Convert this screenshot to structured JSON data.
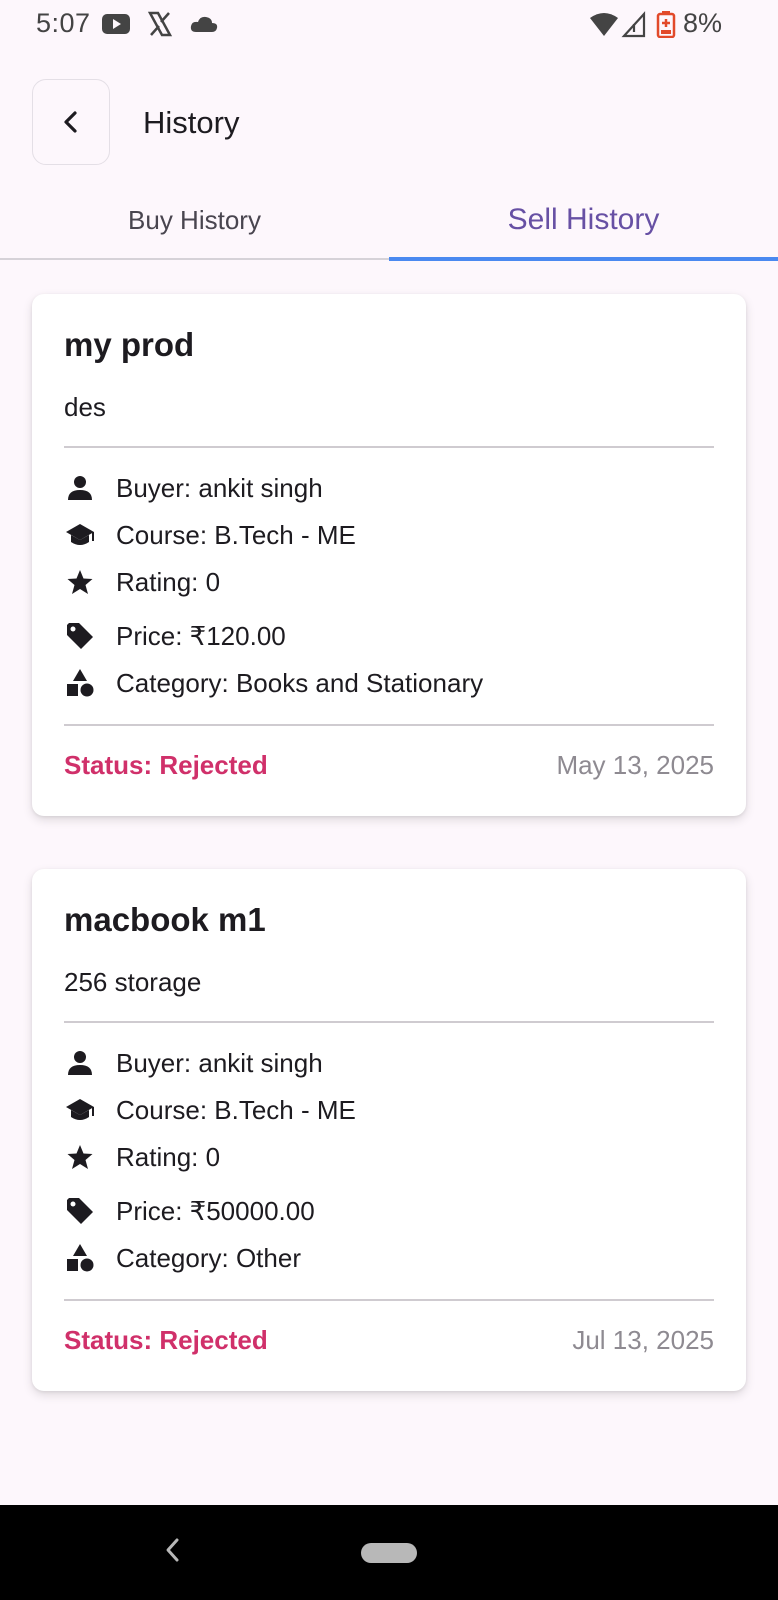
{
  "status_bar": {
    "time": "5:07",
    "battery": "8%",
    "icons": [
      "youtube-icon",
      "x-icon",
      "cloud-icon",
      "wifi-icon",
      "signal-icon",
      "battery-icon"
    ]
  },
  "header": {
    "title": "History",
    "back_icon": "chevron-left-icon"
  },
  "tabs": [
    {
      "label": "Buy History",
      "active": false
    },
    {
      "label": "Sell History",
      "active": true
    }
  ],
  "cards": [
    {
      "title": "my prod",
      "description": "des",
      "buyer": "Buyer: ankit singh",
      "course": "Course: B.Tech - ME",
      "rating": "Rating: 0",
      "price": "Price: ₹120.00",
      "category": "Category: Books and Stationary",
      "status": "Status: Rejected",
      "date": "May 13, 2025"
    },
    {
      "title": "macbook m1",
      "description": "256 storage",
      "buyer": "Buyer: ankit singh",
      "course": "Course: B.Tech - ME",
      "rating": "Rating: 0",
      "price": "Price: ₹50000.00",
      "category": "Category: Other",
      "status": "Status: Rejected",
      "date": "Jul 13, 2025"
    }
  ],
  "colors": {
    "accent": "#6750a4",
    "tab_indicator": "#4a89f0",
    "status_rejected": "#d0306a",
    "background": "#fdf7fc"
  }
}
